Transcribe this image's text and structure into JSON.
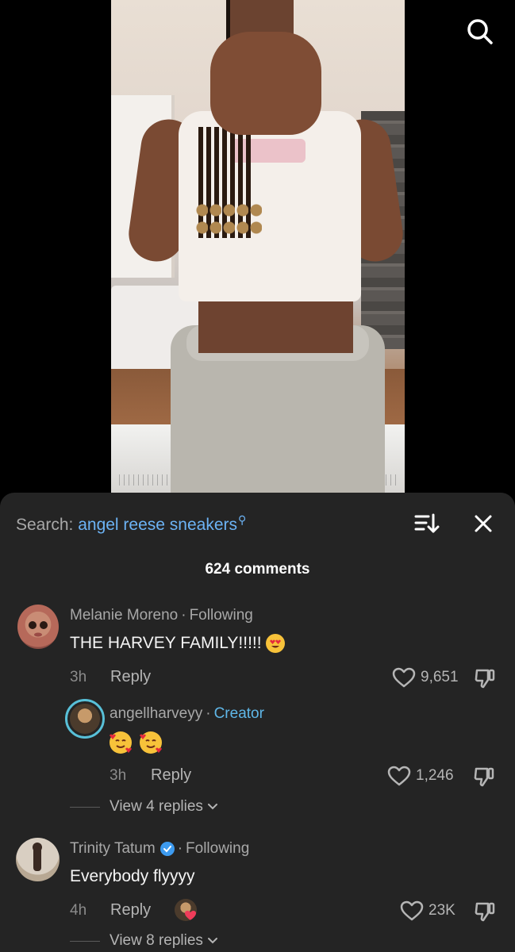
{
  "video": {
    "search_icon": "search-icon"
  },
  "panel": {
    "search": {
      "prefix": "Search:",
      "query": "angel reese sneakers",
      "sort_icon": "sort-icon",
      "close_icon": "close-icon"
    },
    "comment_count": "624 comments",
    "comments": [
      {
        "author": "Melanie Moreno",
        "status": "Following",
        "text": "THE HARVEY FAMILY!!!!!",
        "emoji": "heart-eyes-emoji",
        "time": "3h",
        "reply_label": "Reply",
        "likes": "9,651",
        "replies": [
          {
            "author": "angellharveyy",
            "badge": "Creator",
            "text_emoji": [
              "smiling-face-with-hearts-emoji",
              "smiling-face-with-hearts-emoji"
            ],
            "time": "3h",
            "reply_label": "Reply",
            "likes": "1,246"
          }
        ],
        "view_replies": "View 4 replies"
      },
      {
        "author": "Trinity Tatum",
        "status": "Following",
        "verified": true,
        "text": "Everybody flyyyy",
        "time": "4h",
        "reply_label": "Reply",
        "likes": "23K",
        "view_replies": "View 8 replies"
      }
    ]
  },
  "colors": {
    "panel_bg": "#242424",
    "link_blue": "#6cb3f5",
    "creator_blue": "#5fb7e8",
    "muted_text": "#a8a8a8"
  }
}
